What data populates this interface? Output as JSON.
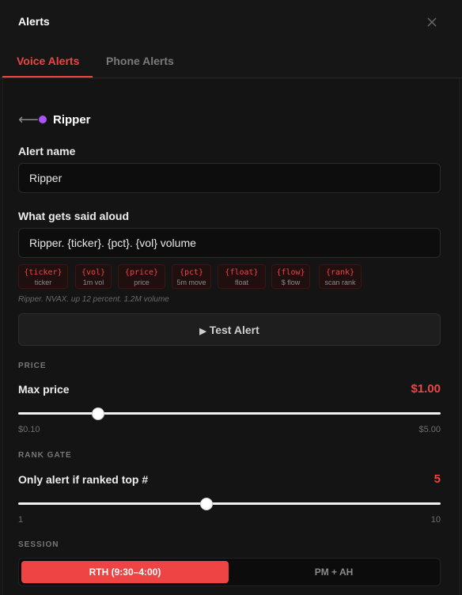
{
  "modal": {
    "title": "Alerts"
  },
  "tabs": [
    {
      "label": "Voice Alerts",
      "active": true
    },
    {
      "label": "Phone Alerts",
      "active": false
    }
  ],
  "alert": {
    "back_glyph": "⟵",
    "name": "Ripper",
    "dot_color": "#a855f7"
  },
  "form": {
    "name_label": "Alert name",
    "name_value": "Ripper",
    "speech_label": "What gets said aloud",
    "speech_value": "Ripper. {ticker}. {pct}. {vol} volume"
  },
  "tokens": [
    {
      "code": "{ticker}",
      "desc": "ticker"
    },
    {
      "code": "{vol}",
      "desc": "1m vol"
    },
    {
      "code": "{price}",
      "desc": "price"
    },
    {
      "code": "{pct}",
      "desc": "5m move"
    },
    {
      "code": "{float}",
      "desc": "float"
    },
    {
      "code": "{flow}",
      "desc": "$ flow"
    },
    {
      "code": "{rank}",
      "desc": "scan rank"
    }
  ],
  "preview_text": "Ripper. NVAX. up 12 percent. 1.2M volume",
  "test_button": {
    "icon": "▶",
    "label": "Test Alert"
  },
  "price": {
    "section": "PRICE",
    "label": "Max price",
    "value": "$1.00",
    "min_label": "$0.10",
    "max_label": "$5.00",
    "fraction": 0.19
  },
  "rank": {
    "section": "RANK GATE",
    "label": "Only alert if ranked top #",
    "value": "5",
    "min_label": "1",
    "max_label": "10",
    "fraction": 0.445
  },
  "session": {
    "section": "SESSION",
    "options": [
      {
        "label": "RTH (9:30–4:00)",
        "selected": true
      },
      {
        "label": "PM + AH",
        "selected": false
      }
    ]
  },
  "colors": {
    "accent": "#ef4444",
    "background": "#161616"
  },
  "icons": {
    "close": "close-icon",
    "back": "arrow-left-icon",
    "play": "play-icon"
  }
}
